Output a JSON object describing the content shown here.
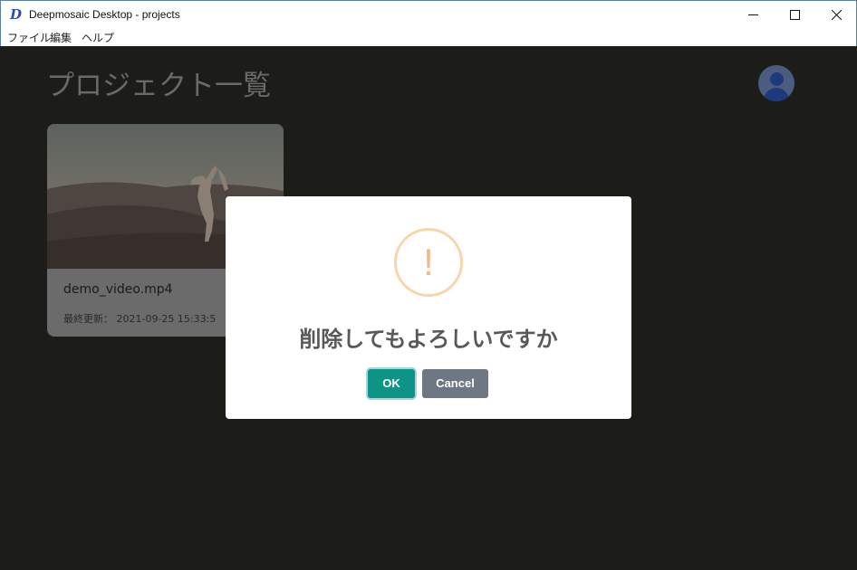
{
  "window": {
    "title": "Deepmosaic Desktop - projects",
    "icon_glyph": "D"
  },
  "menu": {
    "items": [
      "ファイル",
      "編集",
      "ヘルプ"
    ]
  },
  "page": {
    "title": "プロジェクト一覧"
  },
  "projects": [
    {
      "name": "demo_video.mp4",
      "updated": "最終更新： 2021-09-25 15:33:5"
    }
  ],
  "dialog": {
    "icon_glyph": "!",
    "message": "削除してもよろしいですか",
    "ok_label": "OK",
    "cancel_label": "Cancel"
  },
  "colors": {
    "ok_button": "#0e9485",
    "cancel_button": "#6e7883",
    "warning": "#f5b886"
  }
}
